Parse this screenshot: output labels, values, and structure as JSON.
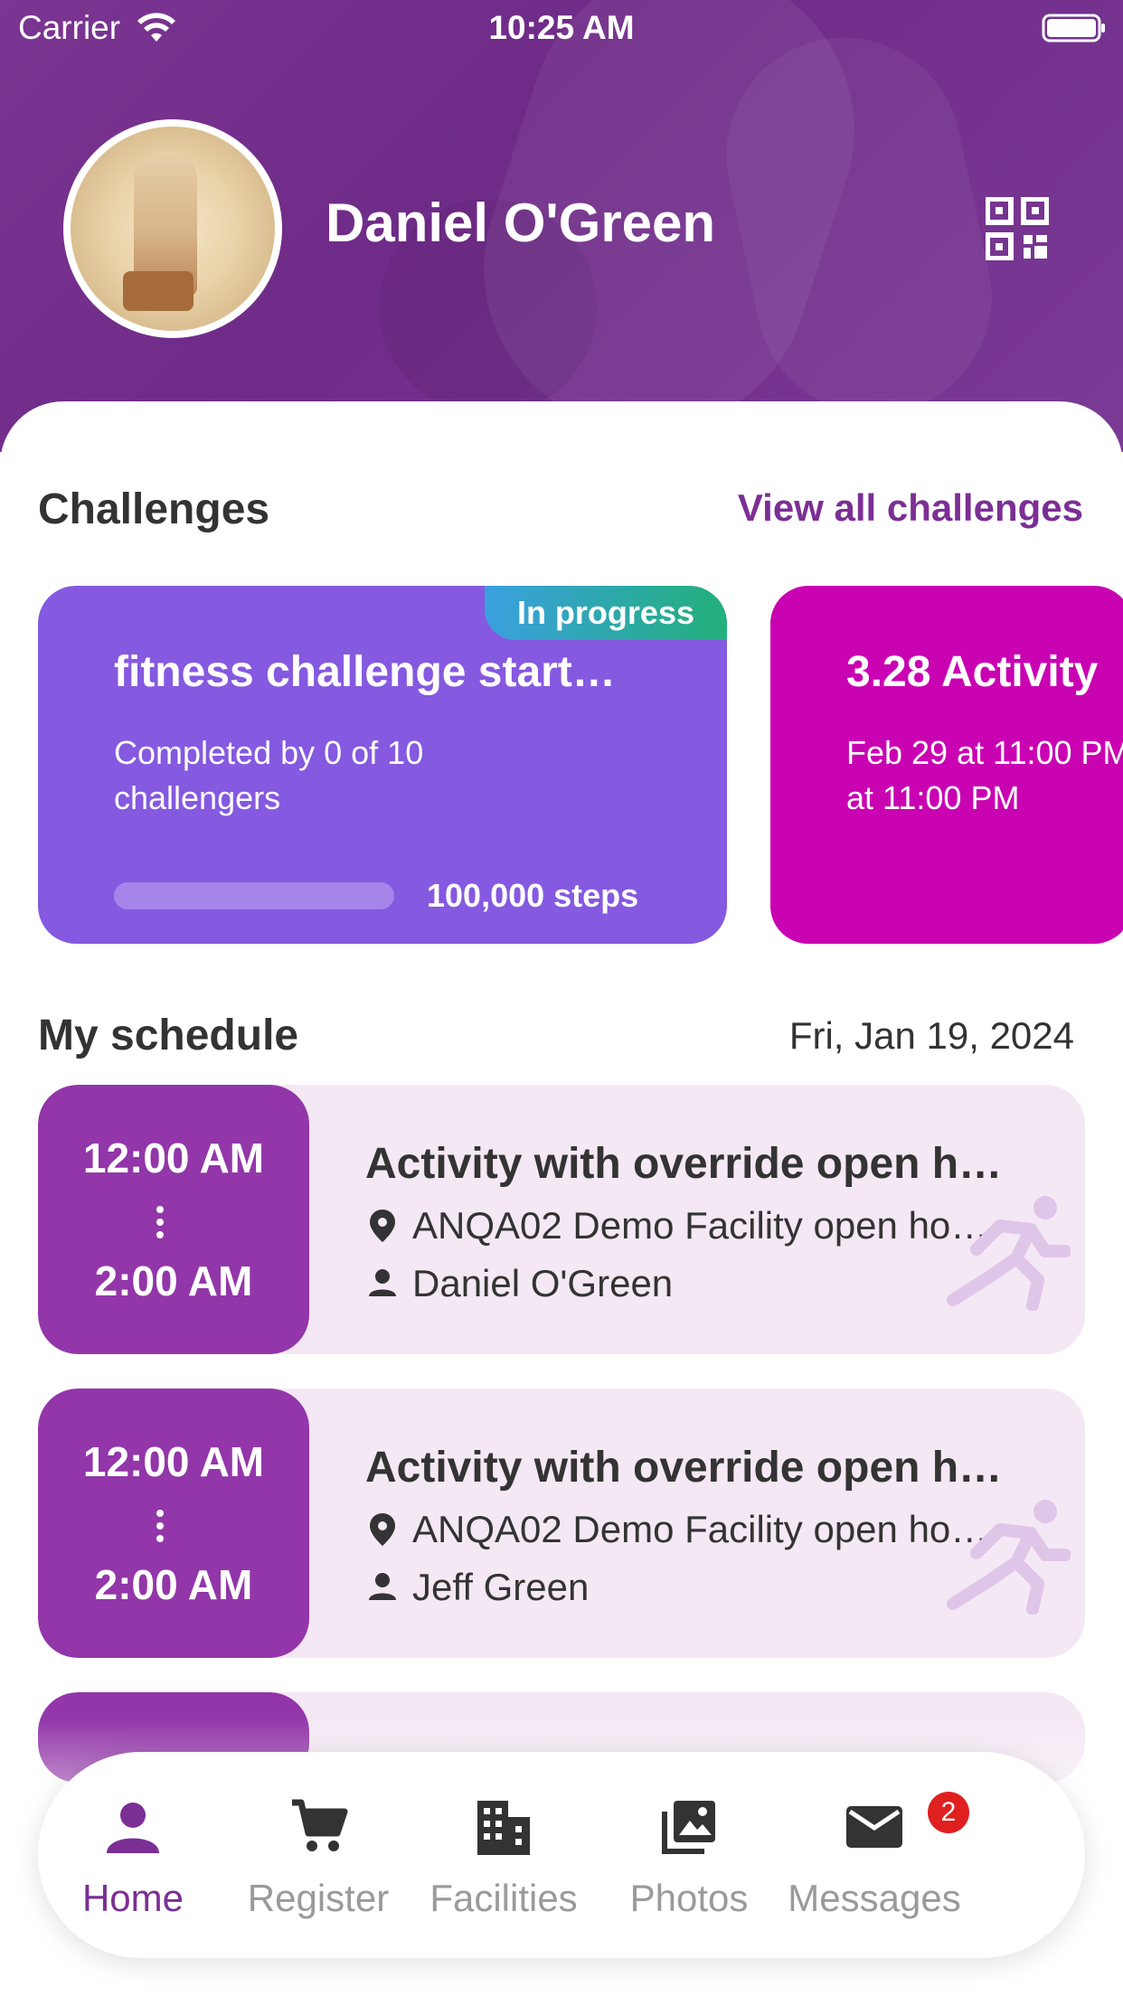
{
  "status_bar": {
    "carrier": "Carrier",
    "time": "10:25 AM"
  },
  "profile": {
    "name": "Daniel O'Green"
  },
  "challenges": {
    "title": "Challenges",
    "view_all": "View all challenges",
    "cards": [
      {
        "badge": "In progress",
        "title": "fitness challenge start…",
        "subtitle": "Completed by 0 of 10 challengers",
        "progress": 0.0,
        "goal": "100,000 steps",
        "color": "#8559e0"
      },
      {
        "title": "3.28 Activity",
        "subtitle_line1": "Feb 29 at 11:00 PM",
        "subtitle_line2": "at 11:00 PM",
        "color": "#c903b2"
      }
    ]
  },
  "schedule": {
    "title": "My schedule",
    "date": "Fri, Jan 19, 2024",
    "items": [
      {
        "start": "12:00 AM",
        "end": "2:00 AM",
        "title": "Activity with override open h…",
        "location": "ANQA02 Demo Facility open ho…",
        "person": "Daniel O'Green"
      },
      {
        "start": "12:00 AM",
        "end": "2:00 AM",
        "title": "Activity with override open h…",
        "location": "ANQA02 Demo Facility open ho…",
        "person": "Jeff Green"
      }
    ]
  },
  "nav": {
    "items": [
      {
        "label": "Home",
        "icon": "person-icon",
        "active": true
      },
      {
        "label": "Register",
        "icon": "cart-icon"
      },
      {
        "label": "Facilities",
        "icon": "building-icon"
      },
      {
        "label": "Photos",
        "icon": "photos-icon"
      },
      {
        "label": "Messages",
        "icon": "mail-icon"
      }
    ],
    "messages_badge": "2"
  },
  "colors": {
    "brand": "#7b2f94",
    "header": "#7b3592",
    "schedule_time": "#9236a9",
    "schedule_bg": "#f4e8f4"
  }
}
